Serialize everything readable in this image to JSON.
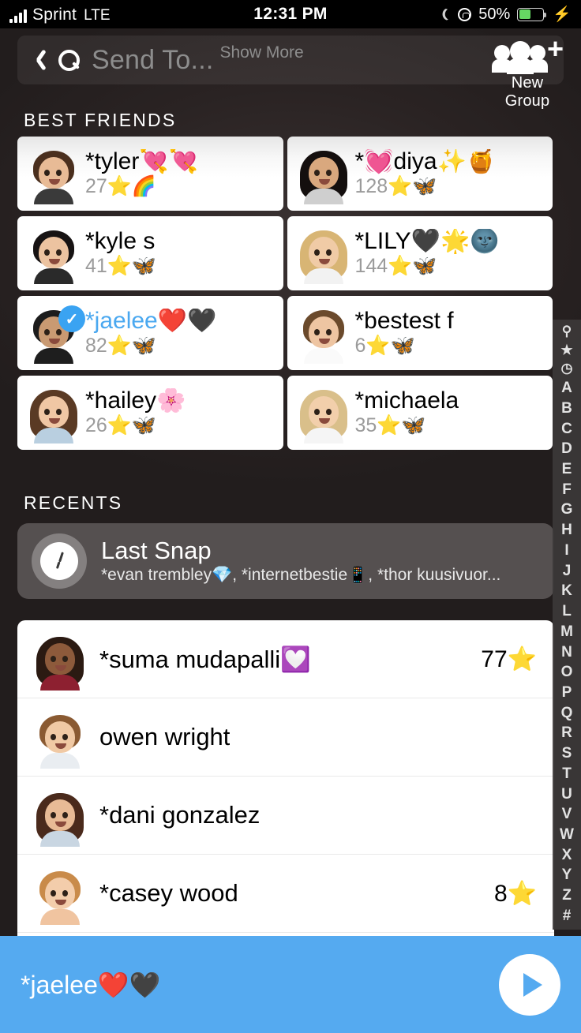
{
  "status_bar": {
    "carrier": "Sprint",
    "network": "LTE",
    "time": "12:31 PM",
    "battery_percent": "50%",
    "battery_level": 50,
    "dnd_icon": "crescent-moon-icon",
    "rotation_lock_icon": "rotation-lock-icon",
    "charging_icon": "lightning-bolt-icon"
  },
  "header": {
    "back_icon": "back-chevron-icon",
    "search_icon": "search-icon",
    "search_placeholder": "Send To...",
    "search_value": "",
    "show_more_label": "Show More",
    "new_group_label": "New Group",
    "new_group_icon": "people-group-plus-icon"
  },
  "sections": {
    "best_friends_title": "BEST FRIENDS",
    "recents_title": "RECENTS"
  },
  "best_friends": [
    {
      "name": "*tyler💘💘",
      "score": "27⭐🌈",
      "selected": false,
      "avatar": "tyler-avatar"
    },
    {
      "name": "*💓diya✨🍯",
      "score": "128⭐🦋",
      "selected": false,
      "avatar": "diya-avatar"
    },
    {
      "name": "*kyle s",
      "score": "41⭐🦋",
      "selected": false,
      "avatar": "kyle-avatar"
    },
    {
      "name": "*LILY🖤🌟🌚",
      "score": "144⭐🦋",
      "selected": false,
      "avatar": "lily-avatar"
    },
    {
      "name": "*jaelee❤️🖤",
      "score": "82⭐🦋",
      "selected": true,
      "avatar": "jaelee-avatar"
    },
    {
      "name": "*bestest f",
      "score": "6⭐🦋",
      "selected": false,
      "avatar": "bestest-avatar"
    },
    {
      "name": "*hailey🌸",
      "score": "26⭐🦋",
      "selected": false,
      "avatar": "hailey-avatar"
    },
    {
      "name": "*michaela",
      "score": "35⭐🦋",
      "selected": false,
      "avatar": "michaela-avatar"
    }
  ],
  "last_snap": {
    "icon": "clock-icon",
    "title": "Last Snap",
    "recipients": "*evan trembley💎, *internetbestie📱, *thor kuusivuor..."
  },
  "friend_list": [
    {
      "name": "*suma mudapalli💟",
      "score": "77⭐",
      "avatar": "suma-avatar"
    },
    {
      "name": "owen wright",
      "score": "",
      "avatar": "owen-avatar"
    },
    {
      "name": "*dani gonzalez",
      "score": "",
      "avatar": "dani-avatar"
    },
    {
      "name": "*casey wood",
      "score": "8⭐",
      "avatar": "casey-avatar"
    }
  ],
  "alpha_index": [
    "search-icon",
    "star-icon",
    "clock-icon",
    "A",
    "B",
    "C",
    "D",
    "E",
    "F",
    "G",
    "H",
    "I",
    "J",
    "K",
    "L",
    "M",
    "N",
    "O",
    "P",
    "Q",
    "R",
    "S",
    "T",
    "U",
    "V",
    "W",
    "X",
    "Y",
    "Z",
    "#"
  ],
  "send_bar": {
    "selected_names": "*jaelee❤️🖤",
    "send_icon": "send-arrow-icon",
    "accent_color": "#55aaf0"
  },
  "colors": {
    "accent_blue": "#55aaf0",
    "selected_name_blue": "#4aa8f0",
    "badge_blue": "#3aa3f2",
    "background": "#221d1d",
    "battery_green": "#66d763"
  }
}
